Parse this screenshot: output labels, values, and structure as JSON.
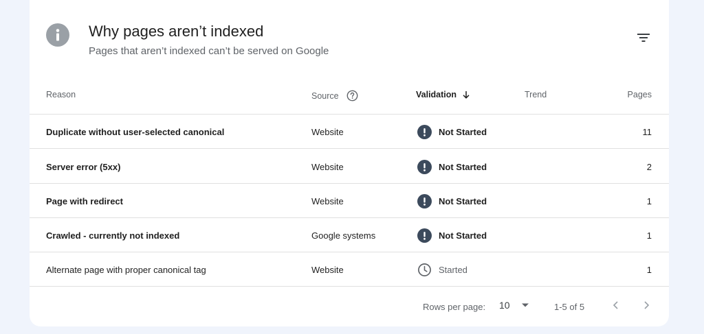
{
  "header": {
    "title": "Why pages aren’t indexed",
    "subtitle": "Pages that aren’t indexed can’t be served on Google"
  },
  "table": {
    "columns": {
      "reason": "Reason",
      "source": "Source",
      "validation": "Validation",
      "trend": "Trend",
      "pages": "Pages"
    },
    "rows": [
      {
        "reason": "Duplicate without user-selected canonical",
        "source": "Website",
        "validation": "Not Started",
        "pages": "11"
      },
      {
        "reason": "Server error (5xx)",
        "source": "Website",
        "validation": "Not Started",
        "pages": "2"
      },
      {
        "reason": "Page with redirect",
        "source": "Website",
        "validation": "Not Started",
        "pages": "1"
      },
      {
        "reason": "Crawled - currently not indexed",
        "source": "Google systems",
        "validation": "Not Started",
        "pages": "1"
      },
      {
        "reason": "Alternate page with proper canonical tag",
        "source": "Website",
        "validation": "Started",
        "pages": "1"
      }
    ]
  },
  "pagination": {
    "rows_per_page_label": "Rows per page:",
    "rows_per_page_value": "10",
    "range": "1-5 of 5"
  },
  "colors": {
    "background": "#f0f4fc",
    "card": "#ffffff",
    "warning_icon": "#3c4a5c",
    "info_icon": "#9aa0a6"
  }
}
